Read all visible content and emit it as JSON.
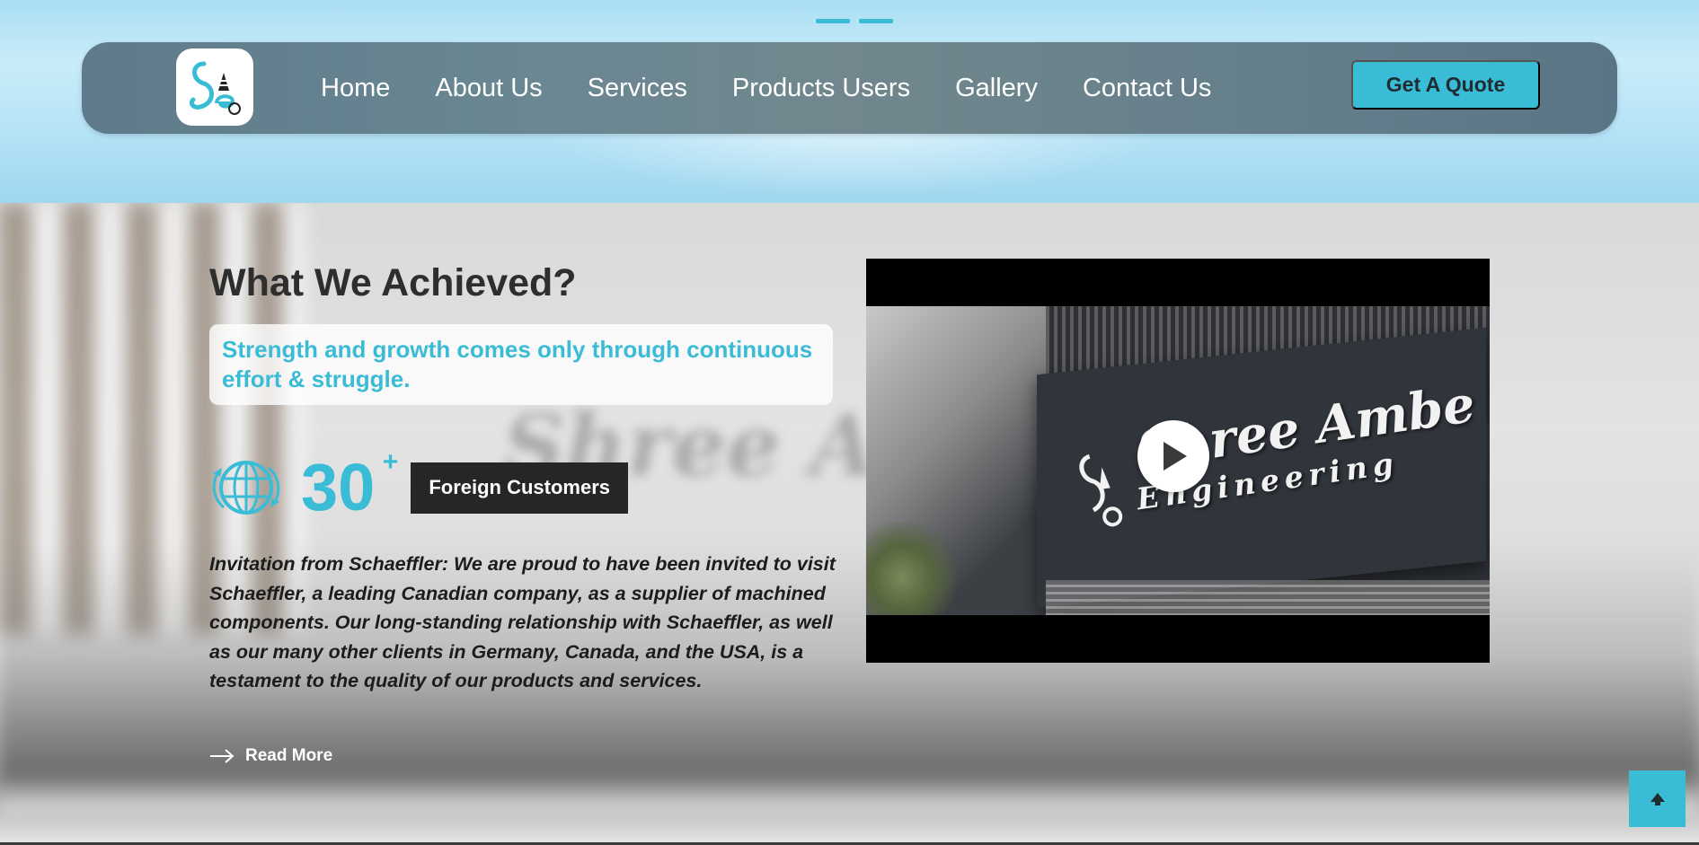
{
  "slider": {
    "dots": 2
  },
  "navbar": {
    "logo_icon": "se-logo-icon",
    "links": [
      "Home",
      "About Us",
      "Services",
      "Products Users",
      "Gallery",
      "Contact Us"
    ],
    "cta_label": "Get A Quote"
  },
  "achievements": {
    "heading": "What We Achieved?",
    "quote": "Strength and growth comes only through continuous effort & struggle.",
    "stat": {
      "icon": "globe-icon",
      "value": "30",
      "suffix": "+",
      "label": "Foreign Customers"
    },
    "description": "Invitation from Schaeffler: We are proud to have been invited to visit Schaeffler, a leading Canadian company, as a supplier of machined components. Our long-standing relationship with Schaeffler, as well as our many other clients in Germany, Canada, and the USA, is a testament to the quality of our products and services.",
    "read_more_label": "Read More"
  },
  "video": {
    "sign_line1": "Shree Ambe",
    "sign_line2": "Engineering",
    "play_icon": "play-icon"
  },
  "background_sign": "Shree Ambe",
  "back_to_top_icon": "arrow-up-icon",
  "colors": {
    "accent": "#3bbcd6",
    "dark_label": "#262626",
    "heading": "#2e2e2e"
  }
}
